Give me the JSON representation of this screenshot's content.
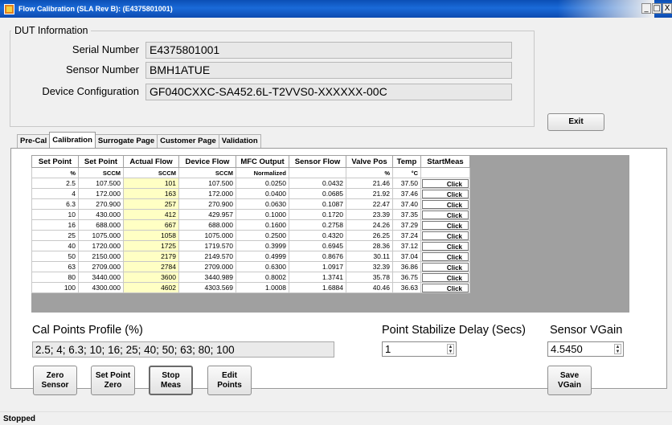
{
  "window": {
    "title": "Flow Calibration (SLA Rev B): (E4375801001)",
    "minimize": "_",
    "maximize": "□",
    "close": "X"
  },
  "dut": {
    "legend": "DUT Information",
    "serial_label": "Serial Number",
    "serial_value": "E4375801001",
    "sensor_label": "Sensor Number",
    "sensor_value": "BMH1ATUE",
    "config_label": "Device Configuration",
    "config_value": "GF040CXXC-SA452.6L-T2VVS0-XXXXXX-00C"
  },
  "exit_label": "Exit",
  "tabs": [
    {
      "label": "Pre-Cal",
      "selected": false
    },
    {
      "label": "Calibration",
      "selected": true
    },
    {
      "label": "Surrogate Page",
      "selected": false
    },
    {
      "label": "Customer Page",
      "selected": false
    },
    {
      "label": "Validation",
      "selected": false
    }
  ],
  "grid": {
    "headers": [
      "Set Point",
      "Set Point",
      "Actual Flow",
      "Device Flow",
      "MFC Output",
      "Sensor Flow",
      "Valve Pos",
      "Temp",
      "StartMeas"
    ],
    "units": [
      "%",
      "SCCM",
      "SCCM",
      "SCCM",
      "Normalized",
      "",
      "%",
      "°C",
      ""
    ],
    "click_label": "Click",
    "rows": [
      [
        "2.5",
        "107.500",
        "101",
        "107.500",
        "0.0250",
        "0.0432",
        "21.46",
        "37.50"
      ],
      [
        "4",
        "172.000",
        "163",
        "172.000",
        "0.0400",
        "0.0685",
        "21.92",
        "37.46"
      ],
      [
        "6.3",
        "270.900",
        "257",
        "270.900",
        "0.0630",
        "0.1087",
        "22.47",
        "37.40"
      ],
      [
        "10",
        "430.000",
        "412",
        "429.957",
        "0.1000",
        "0.1720",
        "23.39",
        "37.35"
      ],
      [
        "16",
        "688.000",
        "667",
        "688.000",
        "0.1600",
        "0.2758",
        "24.26",
        "37.29"
      ],
      [
        "25",
        "1075.000",
        "1058",
        "1075.000",
        "0.2500",
        "0.4320",
        "26.25",
        "37.24"
      ],
      [
        "40",
        "1720.000",
        "1725",
        "1719.570",
        "0.3999",
        "0.6945",
        "28.36",
        "37.12"
      ],
      [
        "50",
        "2150.000",
        "2179",
        "2149.570",
        "0.4999",
        "0.8676",
        "30.11",
        "37.04"
      ],
      [
        "63",
        "2709.000",
        "2784",
        "2709.000",
        "0.6300",
        "1.0917",
        "32.39",
        "36.86"
      ],
      [
        "80",
        "3440.000",
        "3600",
        "3440.989",
        "0.8002",
        "1.3741",
        "35.78",
        "36.75"
      ],
      [
        "100",
        "4300.000",
        "4602",
        "4303.569",
        "1.0008",
        "1.6884",
        "40.46",
        "36.63"
      ]
    ]
  },
  "cal_points": {
    "label": "Cal Points Profile (%)",
    "value": "2.5; 4; 6.3; 10; 16; 25; 40; 50; 63; 80; 100"
  },
  "stabilize": {
    "label": "Point Stabilize Delay (Secs)",
    "value": "1"
  },
  "vgain": {
    "label": "Sensor VGain",
    "value": "4.5450"
  },
  "buttons": {
    "zero_sensor_1": "Zero",
    "zero_sensor_2": "Sensor",
    "set_point_zero_1": "Set Point",
    "set_point_zero_2": "Zero",
    "stop_meas_1": "Stop",
    "stop_meas_2": "Meas",
    "edit_points_1": "Edit",
    "edit_points_2": "Points",
    "save_vgain_1": "Save",
    "save_vgain_2": "VGain"
  },
  "status": "Stopped"
}
